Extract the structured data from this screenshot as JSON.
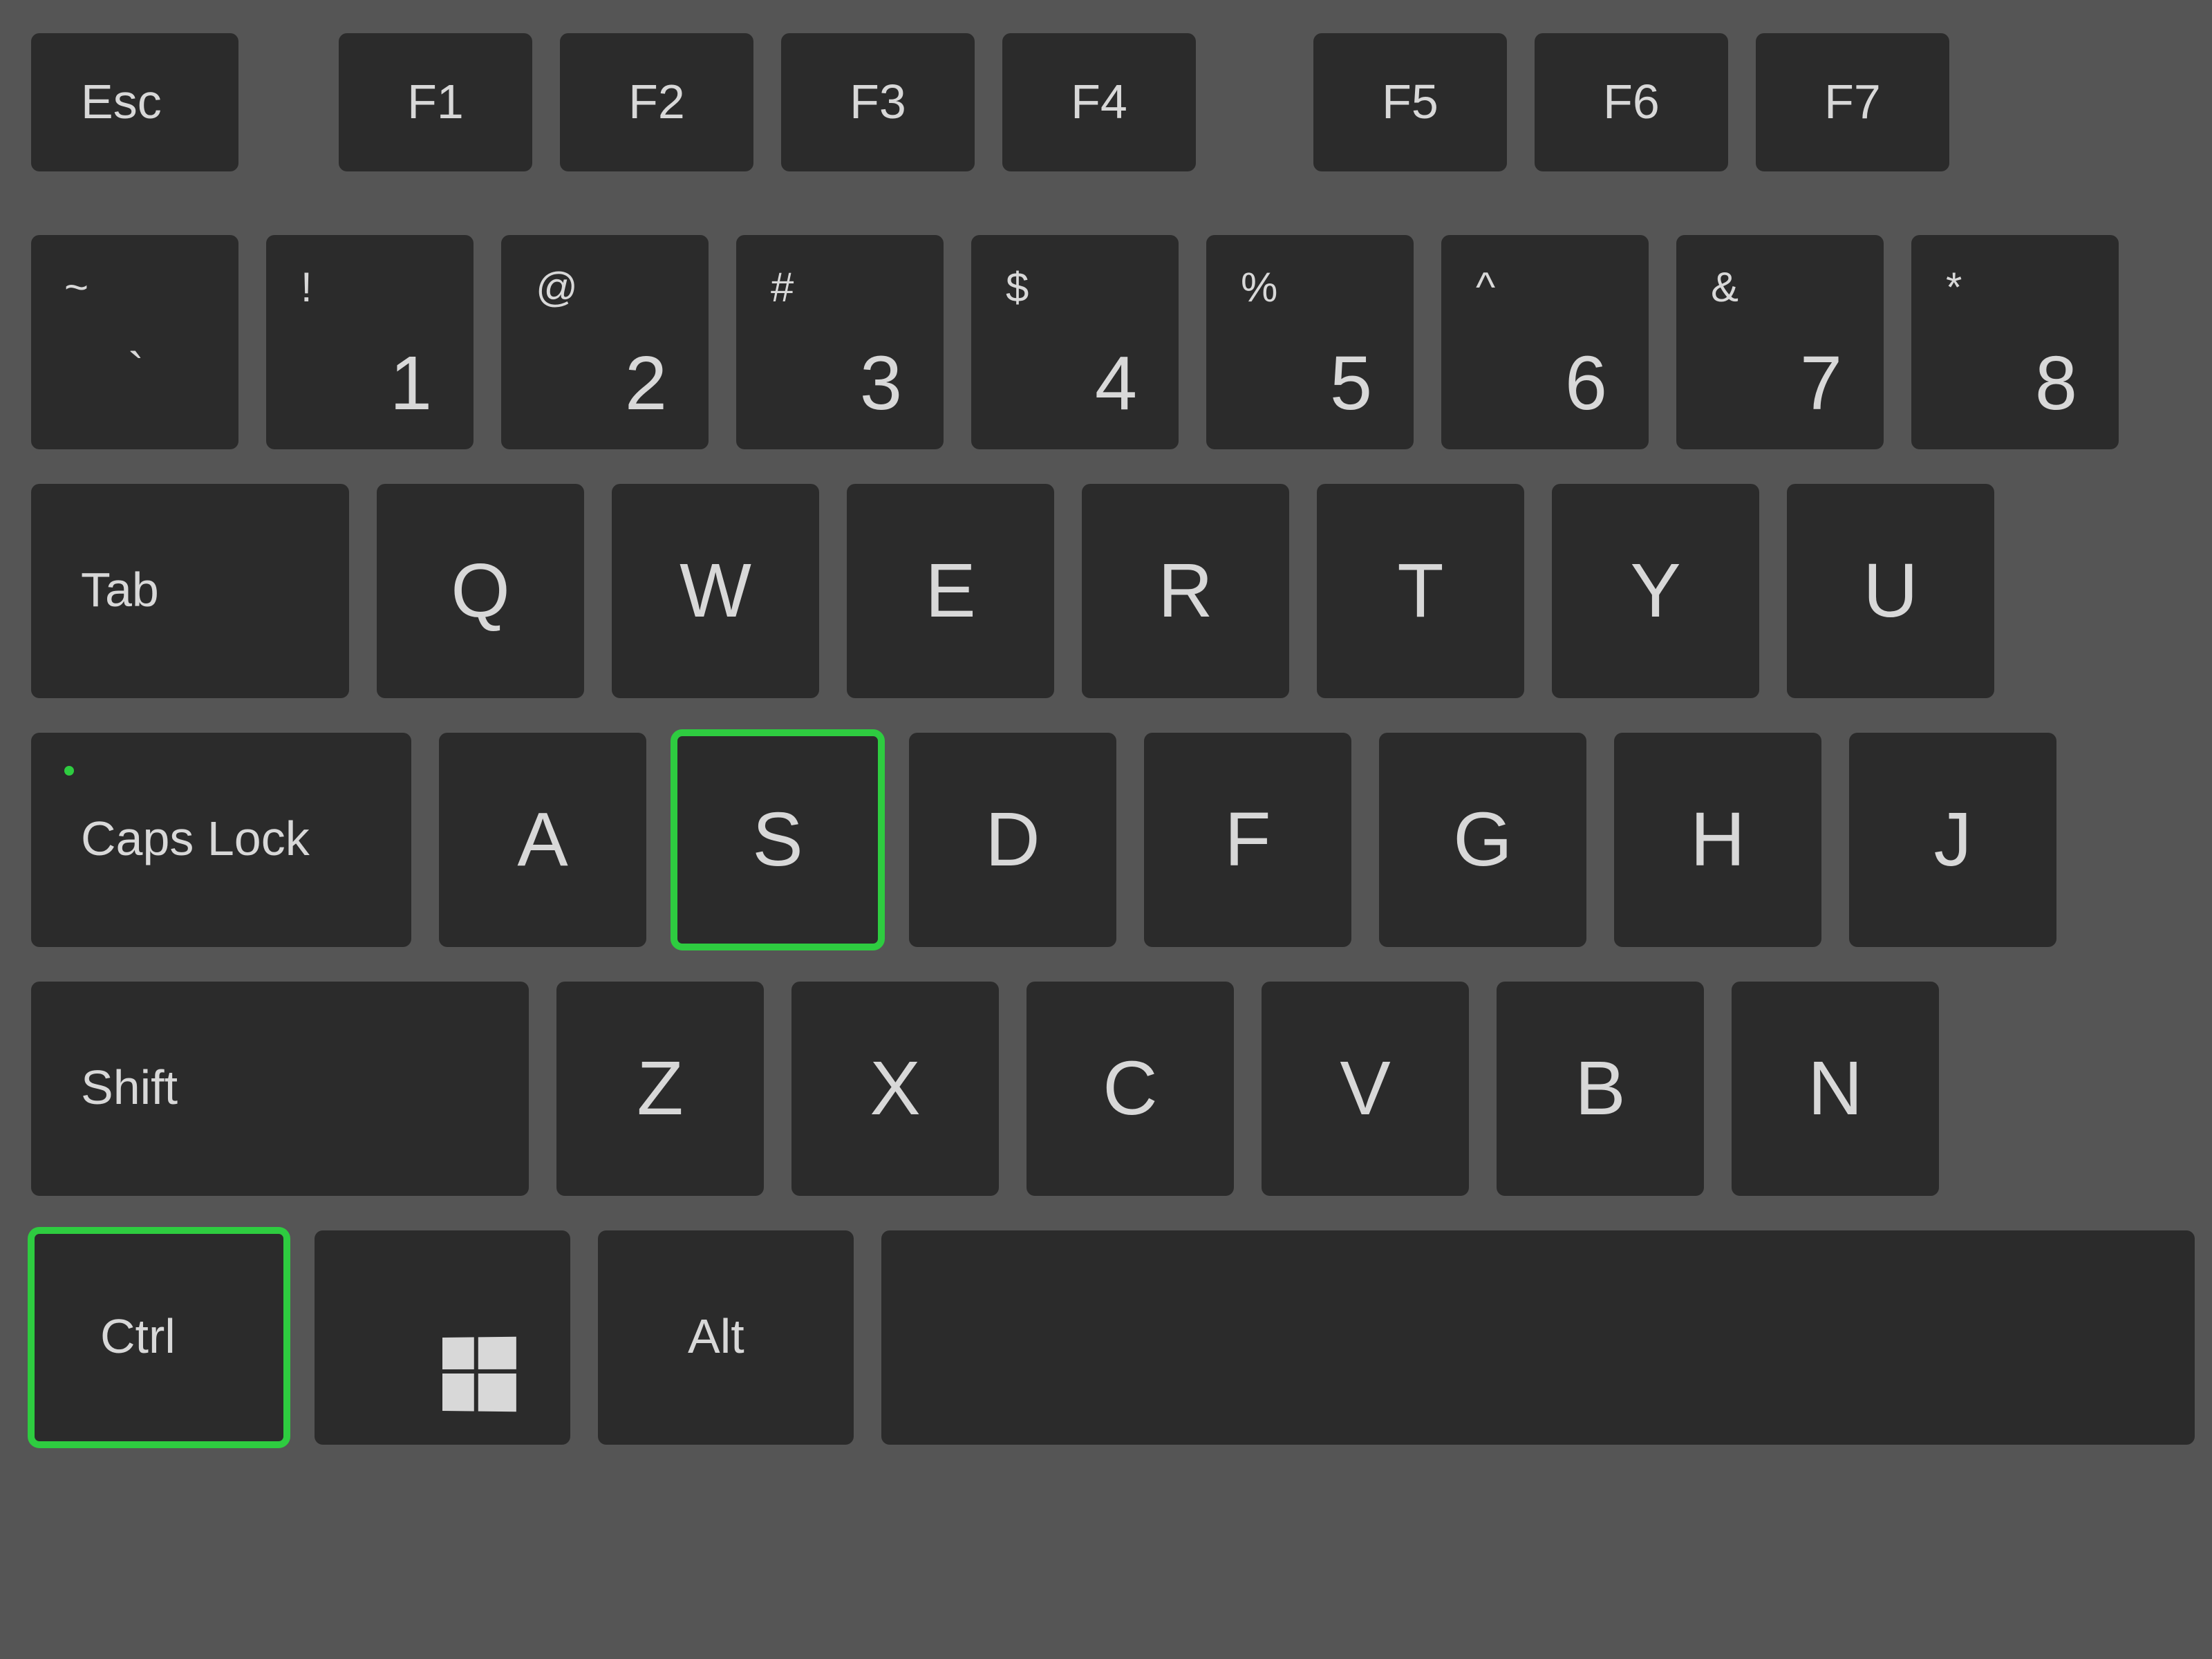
{
  "keyboard": {
    "highlight_color": "#2ecc40",
    "highlighted_keys": [
      "s",
      "ctrl"
    ],
    "keys": {
      "esc": {
        "label": "Esc"
      },
      "f1": {
        "label": "F1"
      },
      "f2": {
        "label": "F2"
      },
      "f3": {
        "label": "F3"
      },
      "f4": {
        "label": "F4"
      },
      "f5": {
        "label": "F5"
      },
      "f6": {
        "label": "F6"
      },
      "f7": {
        "label": "F7"
      },
      "tilde": {
        "upper": "~",
        "lower": "`"
      },
      "d1": {
        "upper": "!",
        "lower": "1"
      },
      "d2": {
        "upper": "@",
        "lower": "2"
      },
      "d3": {
        "upper": "#",
        "lower": "3"
      },
      "d4": {
        "upper": "$",
        "lower": "4"
      },
      "d5": {
        "upper": "%",
        "lower": "5"
      },
      "d6": {
        "upper": "^",
        "lower": "6"
      },
      "d7": {
        "upper": "&",
        "lower": "7"
      },
      "d8": {
        "upper": "*",
        "lower": "8"
      },
      "tab": {
        "label": "Tab"
      },
      "q": {
        "label": "Q"
      },
      "w": {
        "label": "W"
      },
      "e": {
        "label": "E"
      },
      "r": {
        "label": "R"
      },
      "t": {
        "label": "T"
      },
      "y": {
        "label": "Y"
      },
      "u": {
        "label": "U"
      },
      "caps": {
        "label": "Caps Lock"
      },
      "a": {
        "label": "A"
      },
      "s": {
        "label": "S"
      },
      "d": {
        "label": "D"
      },
      "f": {
        "label": "F"
      },
      "g": {
        "label": "G"
      },
      "h": {
        "label": "H"
      },
      "j": {
        "label": "J"
      },
      "shift": {
        "label": "Shift"
      },
      "z": {
        "label": "Z"
      },
      "x": {
        "label": "X"
      },
      "c": {
        "label": "C"
      },
      "v": {
        "label": "V"
      },
      "b": {
        "label": "B"
      },
      "n": {
        "label": "N"
      },
      "ctrl": {
        "label": "Ctrl"
      },
      "win": {
        "label": ""
      },
      "alt": {
        "label": "Alt"
      },
      "space": {
        "label": ""
      }
    }
  }
}
